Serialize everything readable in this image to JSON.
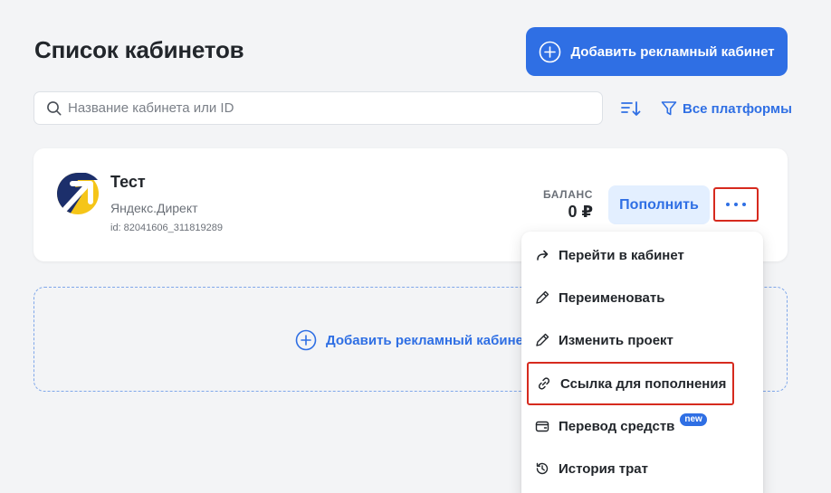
{
  "page": {
    "title": "Список кабинетов"
  },
  "toolbar": {
    "add_button_label": "Добавить рекламный кабинет",
    "search_placeholder": "Название кабинета или ID",
    "search_value": "",
    "filter_label": "Все платформы"
  },
  "account": {
    "name": "Тест",
    "platform": "Яндекс.Директ",
    "id_text": "id: 82041606_311819289",
    "balance_label": "БАЛАНС",
    "balance_value": "0 ₽",
    "topup_label": "Пополнить"
  },
  "add_area": {
    "label": "Добавить рекламный кабинет"
  },
  "menu": {
    "items": [
      {
        "label": "Перейти в кабинет",
        "icon": "share-arrow-icon"
      },
      {
        "label": "Переименовать",
        "icon": "pencil-icon"
      },
      {
        "label": "Изменить проект",
        "icon": "pencil-icon"
      },
      {
        "label": "Ссылка для пополнения",
        "icon": "link-icon",
        "highlighted": true
      },
      {
        "label": "Перевод средств",
        "icon": "wallet-icon",
        "badge": "new"
      },
      {
        "label": "История трат",
        "icon": "history-icon"
      }
    ]
  },
  "colors": {
    "accent": "#2f6fe4",
    "highlight_border": "#d62a1e",
    "background": "#f3f4f6",
    "topup_bg": "#e3efff",
    "logo_bg": "#1c2f6b",
    "logo_arrow": "#f5c518"
  }
}
